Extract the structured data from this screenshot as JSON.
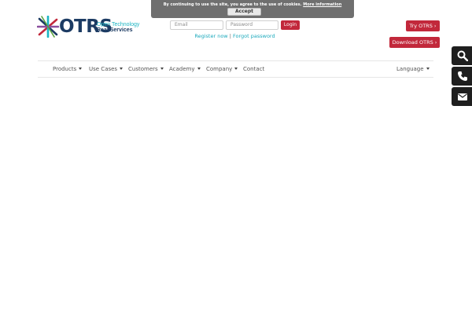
{
  "cookie_banner": {
    "text": "By continuing to use the site, you agree to the use of cookies.",
    "more_label": "More information",
    "accept_label": "Accept"
  },
  "logo": {
    "word": "OTRS",
    "tagline_line1": "Open Technology",
    "tagline_line2": "Real Services"
  },
  "login": {
    "email_placeholder": "Email",
    "password_placeholder": "Password",
    "login_label": "Login",
    "register_label": "Register now",
    "separator": "|",
    "forgot_label": "Forgot password"
  },
  "actions": {
    "try_label": "Try OTRS ›",
    "download_label": "Download OTRS ›"
  },
  "nav": {
    "items": [
      {
        "label": "Products"
      },
      {
        "label": "Use Cases"
      },
      {
        "label": "Customers"
      },
      {
        "label": "Academy"
      },
      {
        "label": "Company"
      },
      {
        "label": "Contact"
      }
    ],
    "language_label": "Language"
  },
  "side_tabs": [
    "search-icon",
    "phone-icon",
    "mail-icon"
  ],
  "colors": {
    "brand_red": "#c2283b",
    "brand_navy": "#1c3b63",
    "brand_teal": "#1bb5c3",
    "link": "#1ba9bc",
    "side_tab_bg": "#1e1e1e"
  }
}
